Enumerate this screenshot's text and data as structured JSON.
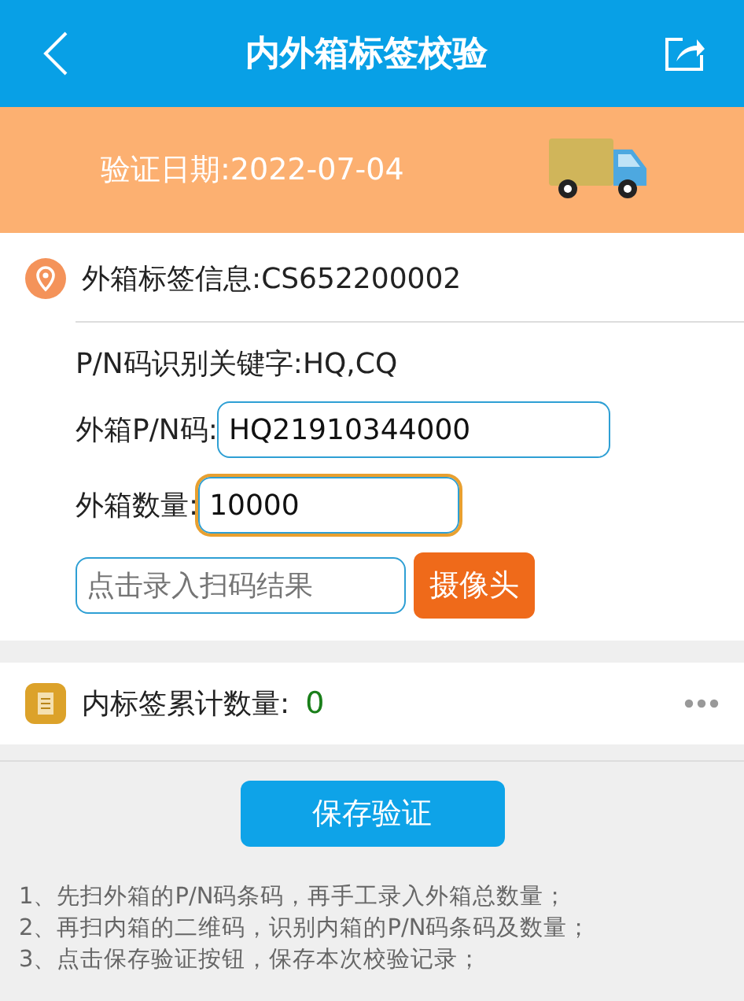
{
  "header": {
    "title": "内外箱标签校验"
  },
  "banner": {
    "date_label": "验证日期:2022-07-04"
  },
  "outer_label": {
    "text": "外箱标签信息:CS652200002"
  },
  "keywords": {
    "text": "P/N码识别关键字:HQ,CQ"
  },
  "fields": [
    {
      "label": "外箱P/N码:",
      "value": "HQ21910344000",
      "focused": false
    },
    {
      "label": "外箱数量:",
      "value": "10000",
      "focused": true
    }
  ],
  "scan": {
    "placeholder": "点击录入扫码结果",
    "button": "摄像头"
  },
  "inner_count": {
    "label": "内标签累计数量:",
    "value": "0"
  },
  "save_button": "保存验证",
  "instructions": [
    "1、先扫外箱的P/N码条码，再手工录入外箱总数量；",
    "2、再扫内箱的二维码，识别内箱的P/N码条码及数量；",
    "3、点击保存验证按钮，保存本次校验记录；"
  ]
}
